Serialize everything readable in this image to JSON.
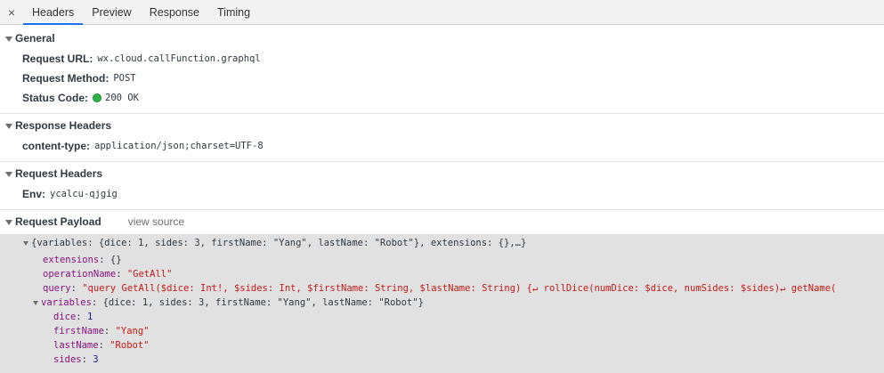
{
  "tabs": {
    "close": "×",
    "items": [
      {
        "label": "Headers",
        "active": true
      },
      {
        "label": "Preview",
        "active": false
      },
      {
        "label": "Response",
        "active": false
      },
      {
        "label": "Timing",
        "active": false
      }
    ]
  },
  "general": {
    "title": "General",
    "request_url_key": "Request URL:",
    "request_url": "wx.cloud.callFunction.graphql",
    "request_method_key": "Request Method:",
    "request_method": "POST",
    "status_code_key": "Status Code:",
    "status_code": "200 OK"
  },
  "response_headers": {
    "title": "Response Headers",
    "content_type_key": "content-type:",
    "content_type": "application/json;charset=UTF-8"
  },
  "request_headers": {
    "title": "Request Headers",
    "env_key": "Env:",
    "env": "ycalcu-qjgig"
  },
  "payload": {
    "title": "Request Payload",
    "view_source": "view source",
    "summary": "{variables: {dice: 1, sides: 3, firstName: \"Yang\", lastName: \"Robot\"}, extensions: {},…}",
    "extensions_key": "extensions",
    "extensions_val": "{}",
    "operationName_key": "operationName",
    "operationName_val": "\"GetAll\"",
    "query_key": "query",
    "query_val": "\"query GetAll($dice: Int!, $sides: Int, $firstName: String, $lastName: String) {↵  rollDice(numDice: $dice, numSides: $sides)↵  getName(",
    "variables_key": "variables",
    "variables_summary": "{dice: 1, sides: 3, firstName: \"Yang\", lastName: \"Robot\"}",
    "dice_key": "dice",
    "dice_val": "1",
    "firstName_key": "firstName",
    "firstName_val": "\"Yang\"",
    "lastName_key": "lastName",
    "lastName_val": "\"Robot\"",
    "sides_key": "sides",
    "sides_val": "3"
  },
  "colors": {
    "accent": "#1a73e8",
    "status_ok": "#2fb344",
    "key": "#881280",
    "string": "#c41a16",
    "number": "#1a1aa6"
  }
}
